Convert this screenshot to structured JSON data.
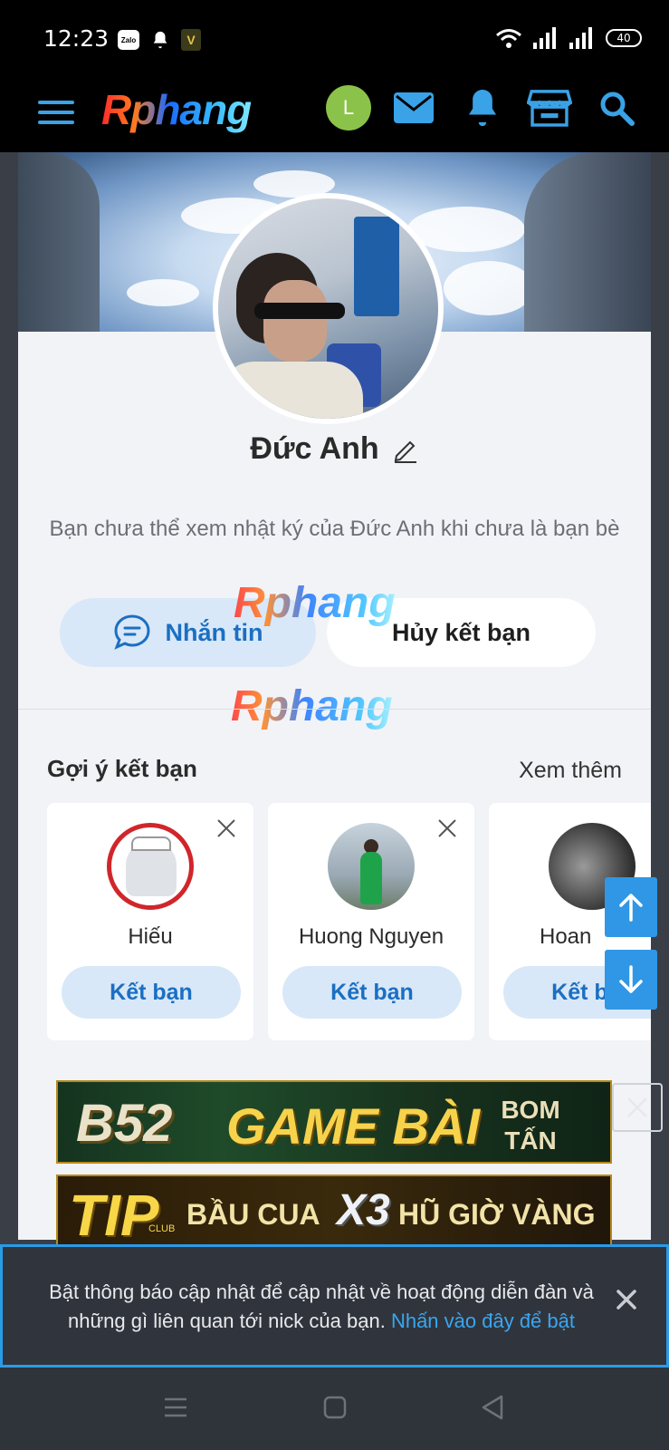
{
  "status_bar": {
    "time": "12:23",
    "battery": "40",
    "zalo_label": "Zalo",
    "v_badge": "V"
  },
  "header": {
    "logo": "Rphang",
    "avatar_letter": "L",
    "icons": [
      "menu-icon",
      "mail-icon",
      "bell-icon",
      "store-icon",
      "search-icon"
    ],
    "accent": "#3aa2e6"
  },
  "profile": {
    "name": "Đức Anh",
    "notice": "Bạn chưa thể xem nhật ký của Đức Anh khi chưa là bạn bè",
    "message_label": "Nhắn tin",
    "unfriend_label": "Hủy kết bạn"
  },
  "watermark": "Rphang",
  "suggestions": {
    "title": "Gợi ý kết bạn",
    "see_more": "Xem thêm",
    "items": [
      {
        "name": "Hiếu",
        "add_label": "Kết bạn"
      },
      {
        "name": "Huong Nguyen",
        "add_label": "Kết bạn"
      },
      {
        "name": "Hoan",
        "add_label": "Kết bạn"
      }
    ]
  },
  "ads": {
    "ad1_brand": "B52",
    "ad1_title": "GAME BÀI",
    "ad1_tag_line1": "BOM",
    "ad1_tag_line2": "TẤN",
    "ad2_brand": "TIP",
    "ad2_sub": "CLUB",
    "ad2_text": "BẦU CUA",
    "ad2_x3": "X3",
    "ad2_tail": "HŨ GIỜ VÀNG"
  },
  "notification": {
    "text": "Bật thông báo cập nhật để cập nhật về hoạt động diễn đàn và những gì liên quan tới nick của bạn.",
    "link": "Nhấn vào đây để bật"
  },
  "colors": {
    "accent_blue": "#1b6fc2",
    "button_bg": "#d8e8f8",
    "banner_border": "#2a9be8"
  }
}
